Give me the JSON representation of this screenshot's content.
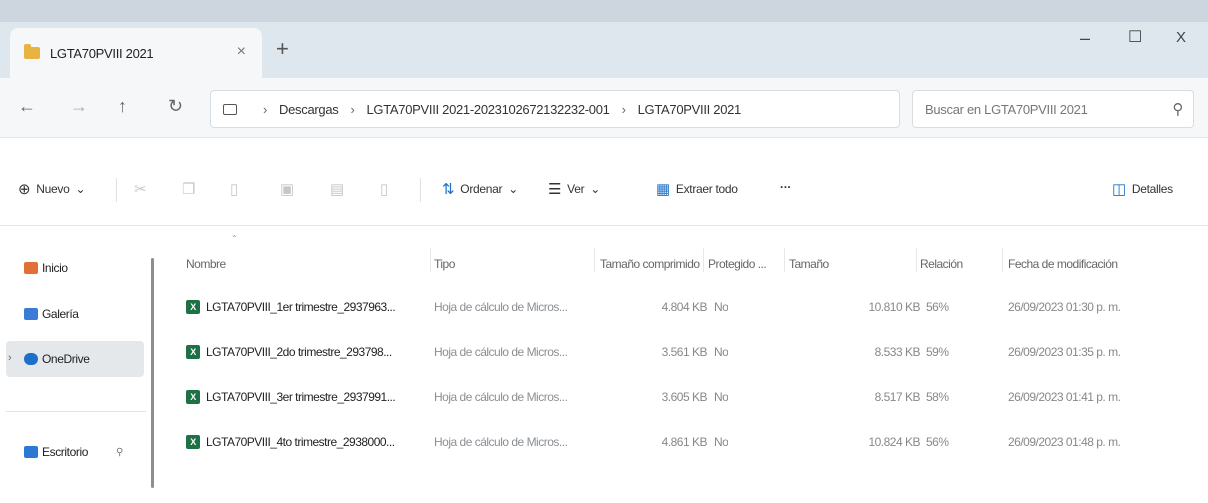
{
  "window": {
    "tab_title": "LGTA70PVIII 2021",
    "tab_close": "×",
    "new_tab": "+",
    "minimize": "–",
    "maximize": "☐",
    "close": "X"
  },
  "nav": {
    "back": "←",
    "forward": "→",
    "up": "↑",
    "refresh": "↻"
  },
  "breadcrumb": [
    "Descargas",
    "LGTA70PVIII 2021-20231026721322​32-001",
    "LGTA70PVIII 2021"
  ],
  "breadcrumb_sep": "›",
  "search": {
    "placeholder": "Buscar en LGTA70PVIII 2021",
    "icon": "⚲"
  },
  "toolbar": {
    "new_label": "Nuevo",
    "sort_label": "Ordenar",
    "view_label": "Ver",
    "extract_label": "Extraer todo",
    "more_label": "···",
    "details_label": "Detalles"
  },
  "sidebar": {
    "items": [
      {
        "label": "Inicio",
        "color": "#e26f35"
      },
      {
        "label": "Galería",
        "color": "#3a7bd5"
      },
      {
        "label": "OneDrive",
        "color": "#1d6fc9"
      },
      {
        "label": "Escritorio",
        "color": "#2b79d3"
      }
    ],
    "pin": "📌"
  },
  "columns": {
    "name": "Nombre",
    "type": "Tipo",
    "compressed": "Tamaño comprimido",
    "protected": "Protegido ...",
    "size": "Tamaño",
    "ratio": "Relación",
    "date": "Fecha de modificación"
  },
  "files": [
    {
      "name": "LGTA70PVIII_1er trimestre_2937963...",
      "type": "Hoja de cálculo de Micros...",
      "compressed": "4.804 KB",
      "protected": "No",
      "size": "10.810 KB",
      "ratio": "56%",
      "date": "26/09/2023 01:30 p. m."
    },
    {
      "name": "LGTA70PVIII_2do trimestre_293798...",
      "type": "Hoja de cálculo de Micros...",
      "compressed": "3.561 KB",
      "protected": "No",
      "size": "8.533 KB",
      "ratio": "59%",
      "date": "26/09/2023 01:35 p. m."
    },
    {
      "name": "LGTA70PVIII_3er trimestre_2937991...",
      "type": "Hoja de cálculo de Micros...",
      "compressed": "3.605 KB",
      "protected": "No",
      "size": "8.517 KB",
      "ratio": "58%",
      "date": "26/09/2023 01:41 p. m."
    },
    {
      "name": "LGTA70PVIII_4to trimestre_2938000...",
      "type": "Hoja de cálculo de Micros...",
      "compressed": "4.861 KB",
      "protected": "No",
      "size": "10.824 KB",
      "ratio": "56%",
      "date": "26/09/2023 01:48 p. m."
    }
  ]
}
